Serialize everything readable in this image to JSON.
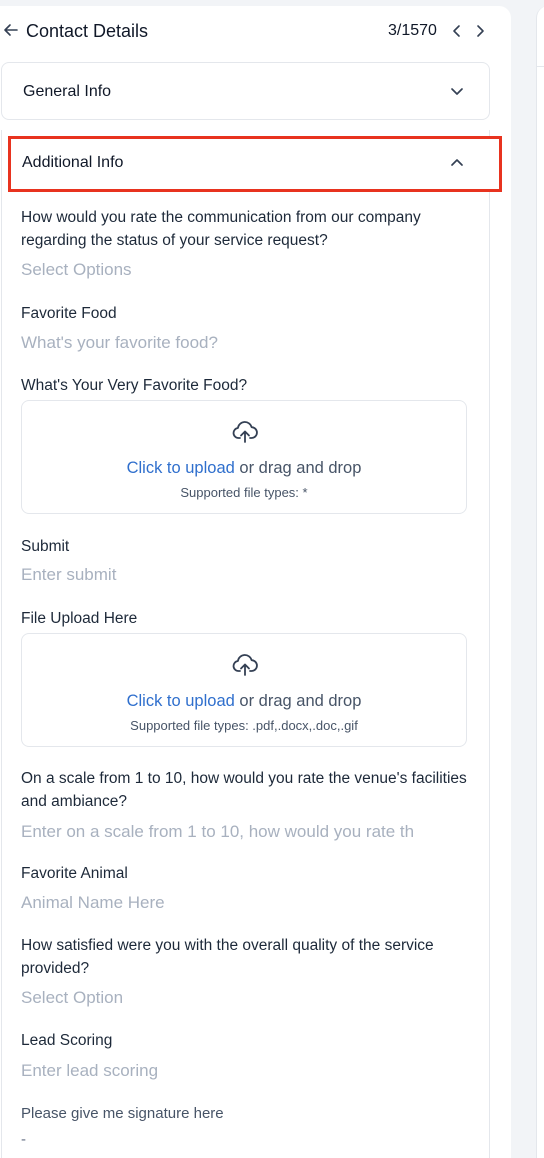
{
  "header": {
    "title": "Contact Details",
    "counter": "3/1570"
  },
  "sections": {
    "general": {
      "label": "General Info"
    },
    "additional": {
      "label": "Additional Info"
    }
  },
  "fields": [
    {
      "label": "How would you rate the communication from our company regarding the status of your service request?",
      "placeholder": "Select Options"
    },
    {
      "label": "Favorite Food",
      "placeholder": "What's your favorite food?"
    },
    {
      "label": "What's Your Very Favorite Food?",
      "upload": {
        "link": "Click to upload",
        "rest": "or drag and drop",
        "types": "Supported file types: *"
      }
    },
    {
      "label": "Submit",
      "placeholder": "Enter submit"
    },
    {
      "label": "File Upload Here",
      "upload": {
        "link": "Click to upload",
        "rest": "or drag and drop",
        "types": "Supported file types: .pdf,.docx,.doc,.gif"
      }
    },
    {
      "label": "On a scale from 1 to 10, how would you rate the venue's facilities and ambiance?",
      "placeholder": "Enter on a scale from 1 to 10, how would you rate th"
    },
    {
      "label": "Favorite Animal",
      "placeholder": "Animal Name Here"
    },
    {
      "label": "How satisfied were you with the overall quality of the service provided?",
      "placeholder": "Select Option"
    },
    {
      "label": "Lead Scoring",
      "placeholder": "Enter lead scoring"
    },
    {
      "label": "Please give me signature here",
      "value": "-"
    }
  ],
  "icons": {
    "back": "arrow-left-icon",
    "prev": "chevron-left-icon",
    "next": "chevron-right-icon",
    "collapse": "chevron-down-icon",
    "expand": "chevron-up-icon",
    "upload": "cloud-upload-icon"
  },
  "colors": {
    "highlight": "#e8331f",
    "link": "#2f6fcd",
    "placeholder": "#a8b1bf"
  }
}
